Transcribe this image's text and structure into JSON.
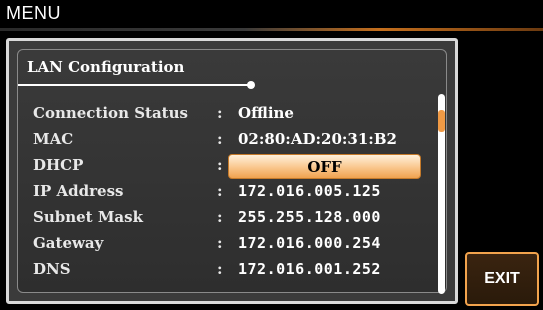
{
  "header": {
    "title": "MENU"
  },
  "panel": {
    "heading": "LAN Configuration",
    "separator": ":",
    "rows": [
      {
        "label": "Connection Status",
        "value": "Offline"
      },
      {
        "label": "MAC",
        "value": "02:80:AD:20:31:B2"
      },
      {
        "label": "DHCP",
        "value": "OFF"
      },
      {
        "label": "IP Address",
        "value": "172.016.005.125"
      },
      {
        "label": "Subnet Mask",
        "value": "255.255.128.000"
      },
      {
        "label": "Gateway",
        "value": "172.016.000.254"
      },
      {
        "label": "DNS",
        "value": "172.016.001.252"
      }
    ]
  },
  "softkeys": {
    "exit_label": "EXIT"
  },
  "colors": {
    "accent": "#f09a45",
    "panel_bg": "#333333",
    "background": "#000000"
  }
}
